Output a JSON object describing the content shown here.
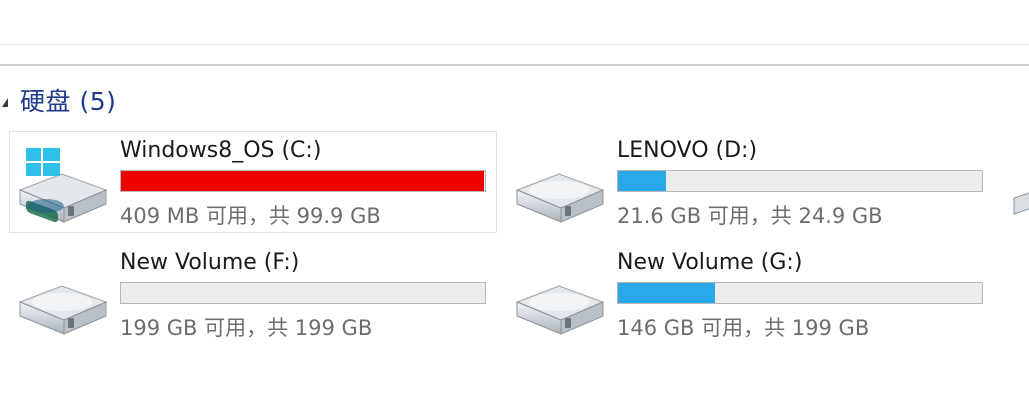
{
  "group": {
    "title": "硬盘 (5)"
  },
  "colors": {
    "bar_critical": "#ee0000",
    "bar_normal": "#2aa9e8",
    "bar_track": "#ececec",
    "group_title": "#1e3b8c"
  },
  "drives": [
    {
      "name": "Windows8_OS (C:)",
      "space": "409 MB 可用，共 99.9 GB",
      "used_fraction": 0.996,
      "status": "critical",
      "icon": "windows-drive-icon",
      "selected": true
    },
    {
      "name": "LENOVO (D:)",
      "space": "21.6 GB 可用，共 24.9 GB",
      "used_fraction": 0.132,
      "status": "normal",
      "icon": "hard-drive-icon",
      "selected": false
    },
    {
      "name": "New Volume (F:)",
      "space": "199 GB 可用，共 199 GB",
      "used_fraction": 0.0,
      "status": "normal",
      "icon": "hard-drive-icon",
      "selected": false
    },
    {
      "name": "New Volume (G:)",
      "space": "146 GB 可用，共 199 GB",
      "used_fraction": 0.266,
      "status": "normal",
      "icon": "hard-drive-icon",
      "selected": false
    }
  ]
}
